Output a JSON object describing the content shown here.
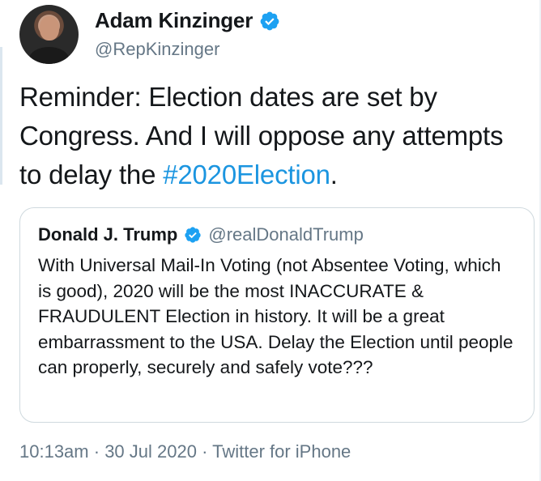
{
  "tweet": {
    "author": {
      "display_name": "Adam Kinzinger",
      "handle": "@RepKinzinger",
      "verified": true
    },
    "text_before_hashtag": "Reminder: Election dates are set by Congress. And I will oppose any attempts to delay the ",
    "hashtag": "#2020Election",
    "text_after_hashtag": "."
  },
  "quoted_tweet": {
    "display_name": "Donald J. Trump",
    "handle": "@realDonaldTrump",
    "verified": true,
    "text": "With Universal Mail-In Voting (not Absentee Voting, which is good), 2020 will be the most INACCURATE & FRAUDULENT Election in history. It will be a great embarrassment to the USA. Delay the Election until people can properly, securely and safely vote???"
  },
  "meta": {
    "time": "10:13am",
    "sep1": " · ",
    "date": "30 Jul 2020",
    "sep2": " · ",
    "source": "Twitter for iPhone"
  },
  "colors": {
    "link": "#1b95e0",
    "verified": "#1da1f2",
    "muted": "#657786",
    "border": "#cfd9de"
  },
  "icons": {
    "verified": "verified-badge-icon"
  }
}
